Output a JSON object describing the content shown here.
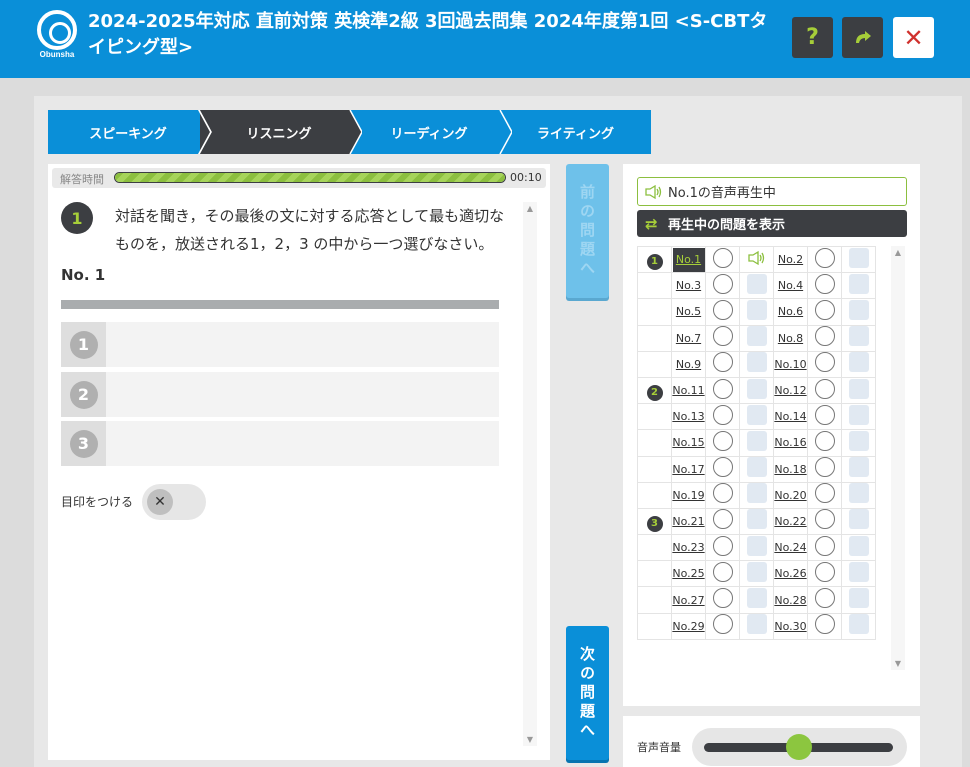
{
  "header": {
    "title": "2024-2025年対応 直前対策 英検準2級 3回過去問集 2024年度第1回 <S-CBTタイピング型>",
    "logo_text": "Obunsha",
    "help_label": "?",
    "reload_label": "↻",
    "close_label": "✕"
  },
  "tabs": [
    {
      "label": "スピーキング"
    },
    {
      "label": "リスニング",
      "active": true
    },
    {
      "label": "リーディング"
    },
    {
      "label": "ライティング"
    }
  ],
  "timer": {
    "label": "解答時間",
    "value": "00:10",
    "progress": 1.0
  },
  "question": {
    "section_number": "1",
    "instruction": "対話を聞き，その最後の文に対する応答として最も適切なものを，放送される1，2，3 の中から一つ選びなさい。",
    "label": "No. 1",
    "choices": [
      "1",
      "2",
      "3"
    ],
    "mark_label": "目印をつける",
    "mark_toggle_icon": "✕"
  },
  "nav": {
    "prev_label": "前の問題へ",
    "next_label": "次の問題へ"
  },
  "side": {
    "now_playing": "No.1の音声再生中",
    "show_playing": "再生中の問題を表示"
  },
  "question_list": [
    {
      "section": "1",
      "left": "No.1",
      "right": "No.2",
      "current": "No.1"
    },
    {
      "section": "",
      "left": "No.3",
      "right": "No.4"
    },
    {
      "section": "",
      "left": "No.5",
      "right": "No.6"
    },
    {
      "section": "",
      "left": "No.7",
      "right": "No.8"
    },
    {
      "section": "",
      "left": "No.9",
      "right": "No.10"
    },
    {
      "section": "2",
      "left": "No.11",
      "right": "No.12"
    },
    {
      "section": "",
      "left": "No.13",
      "right": "No.14"
    },
    {
      "section": "",
      "left": "No.15",
      "right": "No.16"
    },
    {
      "section": "",
      "left": "No.17",
      "right": "No.18"
    },
    {
      "section": "",
      "left": "No.19",
      "right": "No.20"
    },
    {
      "section": "3",
      "left": "No.21",
      "right": "No.22"
    },
    {
      "section": "",
      "left": "No.23",
      "right": "No.24"
    },
    {
      "section": "",
      "left": "No.25",
      "right": "No.26"
    },
    {
      "section": "",
      "left": "No.27",
      "right": "No.28"
    },
    {
      "section": "",
      "left": "No.29",
      "right": "No.30"
    }
  ],
  "volume": {
    "label": "音声音量",
    "level": 0.5
  },
  "colors": {
    "brand_blue": "#0a8fd8",
    "dark": "#3c3e42",
    "accent_green": "#a6ce39"
  }
}
